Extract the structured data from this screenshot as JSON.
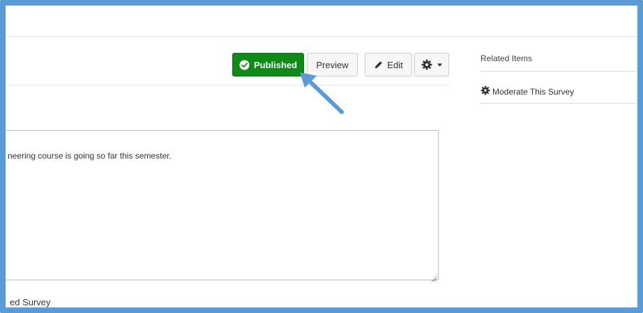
{
  "toolbar": {
    "published_label": "Published",
    "preview_label": "Preview",
    "edit_label": "Edit"
  },
  "description": {
    "text": "neering course is going so far this semester."
  },
  "survey_label": "ed Survey",
  "sidebar": {
    "related_title": "Related Items",
    "moderate_label": "Moderate This Survey"
  },
  "icons": {
    "published": "check-circle-icon",
    "edit": "pencil-icon",
    "settings": "gear-icon",
    "settings_caret": "caret-down-icon",
    "moderate": "gear-icon"
  },
  "colors": {
    "published_bg": "#0e8a16",
    "annotation": "#5b9bd5"
  }
}
